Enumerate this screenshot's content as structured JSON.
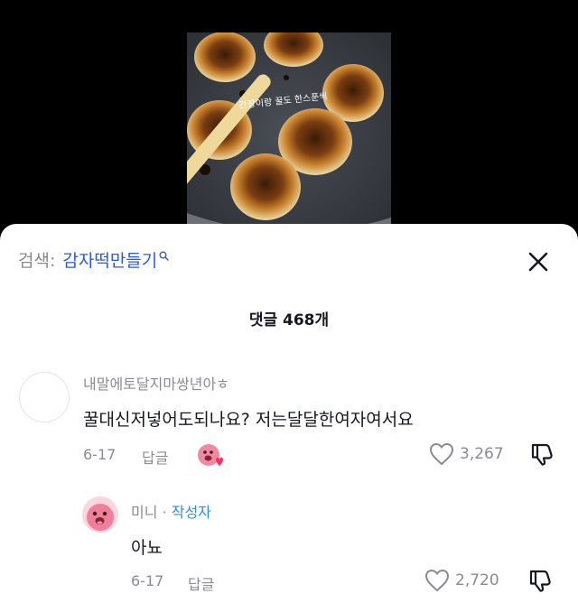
{
  "video": {
    "overlay_caption": "간장이랑 꿀도 한스푼씩"
  },
  "search": {
    "label": "검색:",
    "query": "감자떡만들기",
    "icon": "search-icon"
  },
  "comments_header": {
    "title": "댓글 468개"
  },
  "comments": [
    {
      "username": "내말에토달지마쌍년아ㅎ",
      "text": "꿀대신저넣어도되나요? 저는달달한여자여서요",
      "date": "6-17",
      "reply_label": "답글",
      "likes": "3,267"
    },
    {
      "username": "미니",
      "separator": " · ",
      "author_badge": "작성자",
      "text": "아뇨",
      "date": "6-17",
      "reply_label": "답글",
      "likes": "2,720"
    }
  ],
  "colors": {
    "accent_blue": "#2a5bd7",
    "author_tag": "#2f8fd8",
    "muted": "#8a8b91",
    "avatar_pink": "#fbd6df"
  }
}
